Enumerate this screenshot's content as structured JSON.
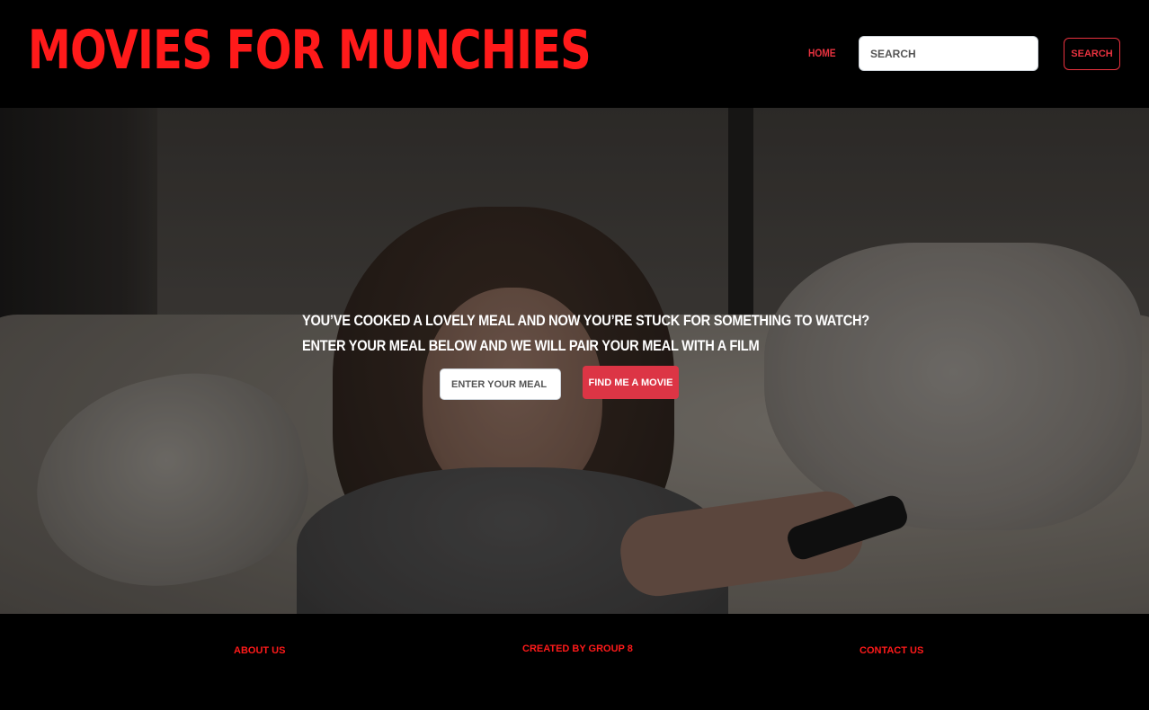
{
  "navbar": {
    "brand": "Movies for Munchies",
    "home_link": "Home",
    "search_placeholder": "Search",
    "search_button": "Search",
    "accent_color": "#ff1a1a"
  },
  "hero": {
    "line1": "You’ve cooked a lovely meal and now you’re stuck for something to watch?",
    "line2": "Enter your meal below and we will pair your meal with a film",
    "meal_placeholder": "Enter your meal",
    "find_button": "Find me a movie",
    "button_color": "#dc3545"
  },
  "footer": {
    "about": "About Us",
    "created_by": "Created by Group 8",
    "contact": "Contact Us"
  }
}
